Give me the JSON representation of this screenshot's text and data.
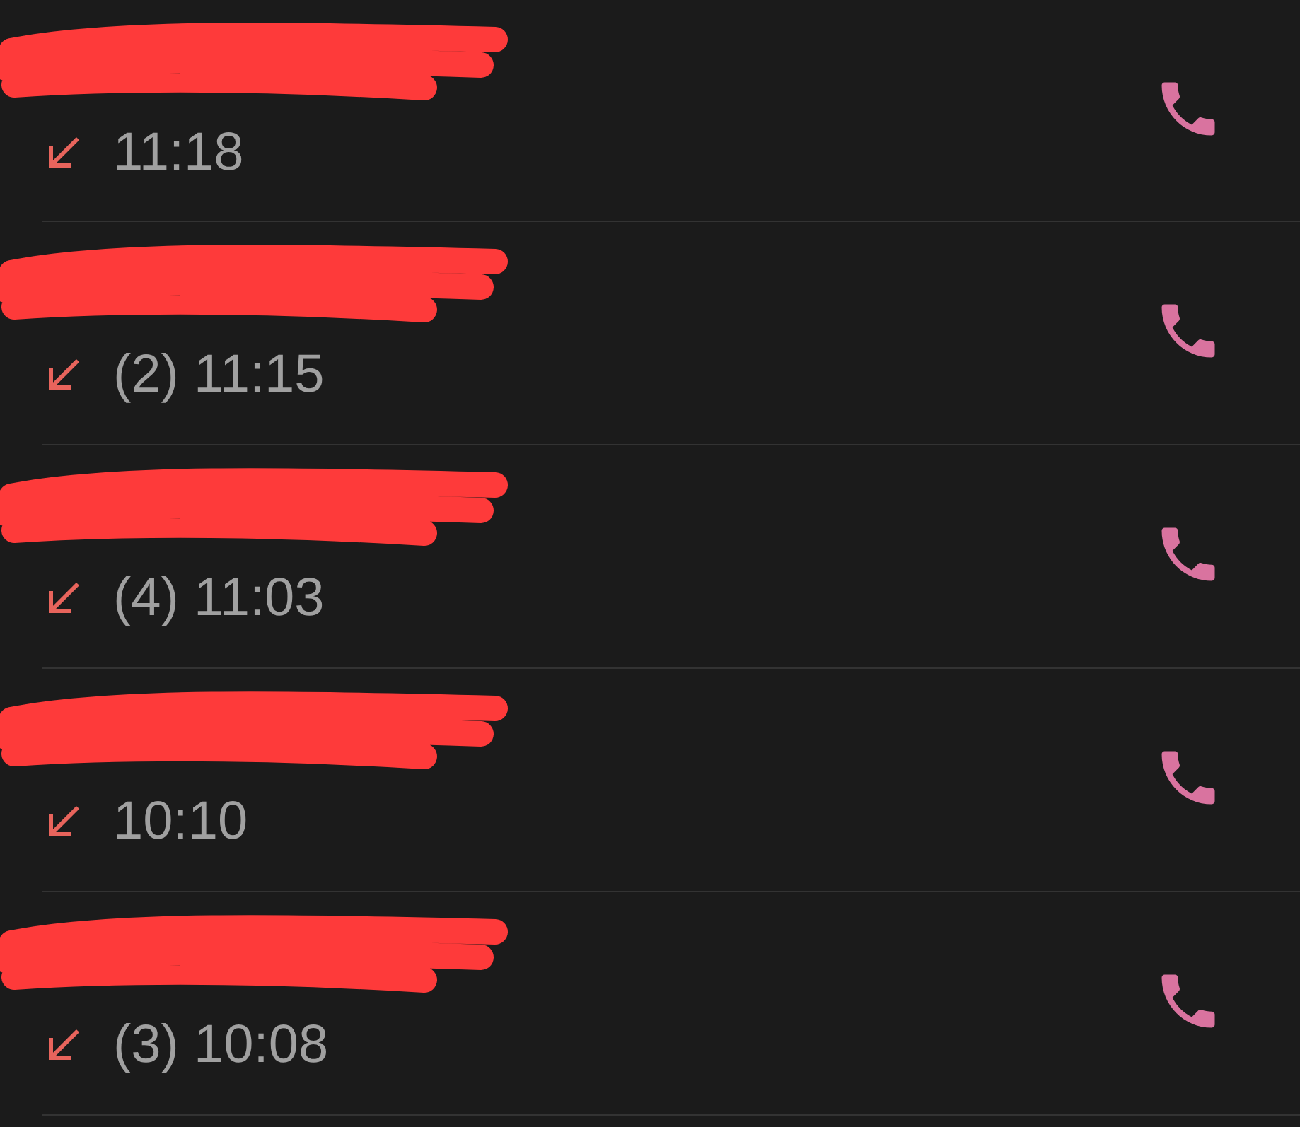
{
  "calls": [
    {
      "kind": "missed",
      "detail": "11:18"
    },
    {
      "kind": "missed",
      "detail": "(2) 11:15"
    },
    {
      "kind": "missed",
      "detail": "(4) 11:03"
    },
    {
      "kind": "missed",
      "detail": "10:10"
    },
    {
      "kind": "missed",
      "detail": "(3) 10:08"
    }
  ]
}
